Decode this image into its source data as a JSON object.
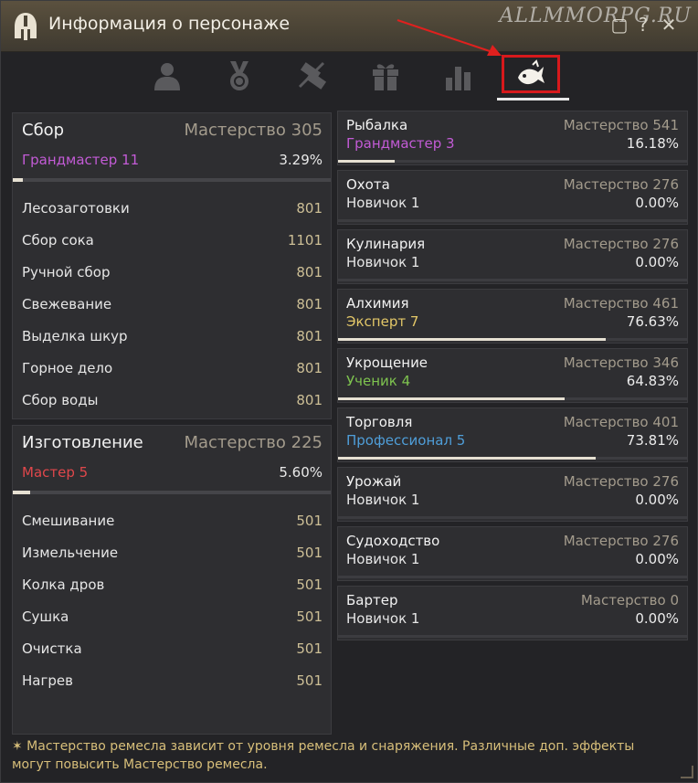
{
  "window": {
    "title": "Информация о персонаже",
    "watermark": "ALLMMORPG.RU"
  },
  "titlebar_buttons": {
    "restore": "▢",
    "help": "?",
    "close": "✕"
  },
  "tabs": [
    {
      "icon": "person-icon"
    },
    {
      "icon": "medal-icon"
    },
    {
      "icon": "scroll-icon"
    },
    {
      "icon": "gift-icon"
    },
    {
      "icon": "bar-chart-icon"
    },
    {
      "icon": "fish-icon",
      "active": true
    }
  ],
  "gathering": {
    "title": "Сбор",
    "mastery": "Мастерство 305",
    "rank": "Грандмастер 11",
    "rank_color": "#c35bd6",
    "percent": "3.29%",
    "progress": 0.0329,
    "items": [
      {
        "name": "Лесозаготовки",
        "value": "801"
      },
      {
        "name": "Сбор сока",
        "value": "1101"
      },
      {
        "name": "Ручной сбор",
        "value": "801"
      },
      {
        "name": "Свежевание",
        "value": "801"
      },
      {
        "name": "Выделка шкур",
        "value": "801"
      },
      {
        "name": "Горное дело",
        "value": "801"
      },
      {
        "name": "Сбор воды",
        "value": "801"
      }
    ]
  },
  "crafting": {
    "title": "Изготовление",
    "mastery": "Мастерство 225",
    "rank": "Мастер 5",
    "rank_color": "#e0474b",
    "percent": "5.60%",
    "progress": 0.056,
    "items": [
      {
        "name": "Смешивание",
        "value": "501"
      },
      {
        "name": "Измельчение",
        "value": "501"
      },
      {
        "name": "Колка дров",
        "value": "501"
      },
      {
        "name": "Сушка",
        "value": "501"
      },
      {
        "name": "Очистка",
        "value": "501"
      },
      {
        "name": "Нагрев",
        "value": "501"
      }
    ]
  },
  "skills": [
    {
      "name": "Рыбалка",
      "mastery": "Мастерство 541",
      "rank": "Грандмастер 3",
      "rank_color": "#c35bd6",
      "percent": "16.18%",
      "progress": 0.1618
    },
    {
      "name": "Охота",
      "mastery": "Мастерство 276",
      "rank": "Новичок 1",
      "rank_color": "#e6e6e6",
      "percent": "0.00%",
      "progress": 0
    },
    {
      "name": "Кулинария",
      "mastery": "Мастерство 276",
      "rank": "Новичок 1",
      "rank_color": "#e6e6e6",
      "percent": "0.00%",
      "progress": 0
    },
    {
      "name": "Алхимия",
      "mastery": "Мастерство 461",
      "rank": "Эксперт 7",
      "rank_color": "#e3c768",
      "percent": "76.63%",
      "progress": 0.7663
    },
    {
      "name": "Укрощение",
      "mastery": "Мастерство 346",
      "rank": "Ученик 4",
      "rank_color": "#7ec34f",
      "percent": "64.83%",
      "progress": 0.6483
    },
    {
      "name": "Торговля",
      "mastery": "Мастерство 401",
      "rank": "Профессионал 5",
      "rank_color": "#4f9ed9",
      "percent": "73.81%",
      "progress": 0.7381
    },
    {
      "name": "Урожай",
      "mastery": "Мастерство 276",
      "rank": "Новичок 1",
      "rank_color": "#e6e6e6",
      "percent": "0.00%",
      "progress": 0
    },
    {
      "name": "Судоходство",
      "mastery": "Мастерство 276",
      "rank": "Новичок 1",
      "rank_color": "#e6e6e6",
      "percent": "0.00%",
      "progress": 0
    },
    {
      "name": "Бартер",
      "mastery": "Мастерство 0",
      "rank": "Новичок 1",
      "rank_color": "#e6e6e6",
      "percent": "0.00%",
      "progress": 0
    }
  ],
  "footer": {
    "line1": "✶ Мастерство ремесла зависит от уровня ремесла и снаряжения. Различные доп. эффекты",
    "line2": "могут повысить Мастерство ремесла."
  }
}
